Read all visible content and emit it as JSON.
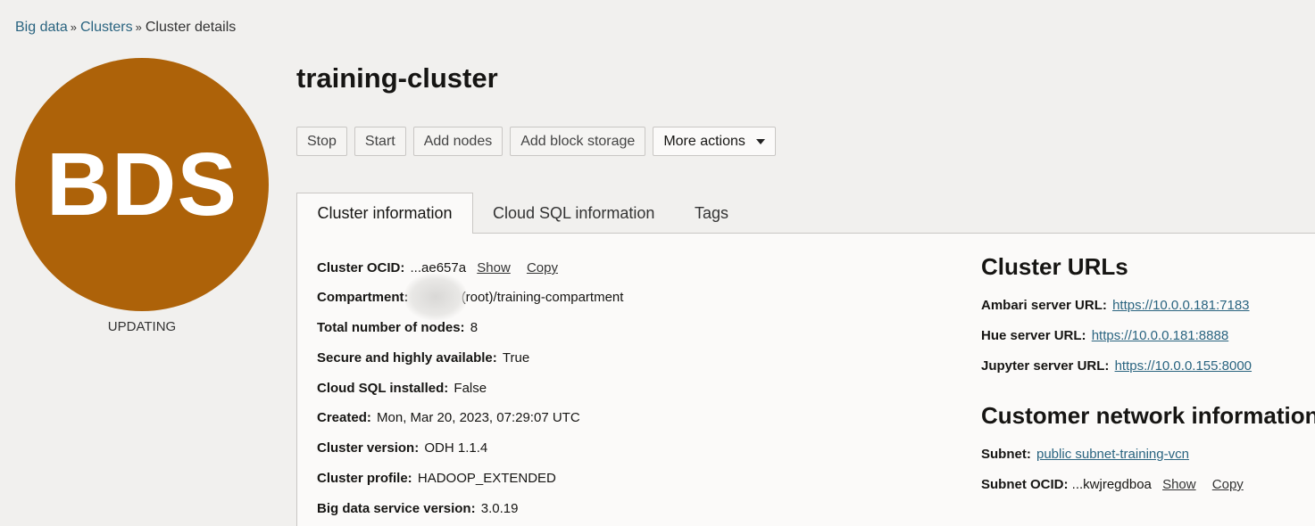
{
  "breadcrumb": {
    "items": [
      "Big data",
      "Clusters"
    ],
    "current": "Cluster details",
    "separator": "»"
  },
  "badge": {
    "text": "BDS",
    "status": "UPDATING",
    "color": "#ad6209"
  },
  "title": "training-cluster",
  "actions": {
    "stop": "Stop",
    "start": "Start",
    "add_nodes": "Add nodes",
    "add_block_storage": "Add block storage",
    "more_actions": "More actions"
  },
  "tabs": [
    "Cluster information",
    "Cloud SQL information",
    "Tags"
  ],
  "cluster_info": {
    "ocid": {
      "label": "Cluster OCID:",
      "value": "...ae657a",
      "show": "Show",
      "copy": "Copy"
    },
    "compartment": {
      "label": "Compartment:",
      "value": "(root)/training-compartment"
    },
    "total_nodes": {
      "label": "Total number of nodes:",
      "value": "8"
    },
    "secure_ha": {
      "label": "Secure and highly available:",
      "value": "True"
    },
    "cloud_sql": {
      "label": "Cloud SQL installed:",
      "value": "False"
    },
    "created": {
      "label": "Created:",
      "value": "Mon, Mar 20, 2023, 07:29:07 UTC"
    },
    "cluster_version": {
      "label": "Cluster version:",
      "value": "ODH 1.1.4"
    },
    "cluster_profile": {
      "label": "Cluster profile:",
      "value": "HADOOP_EXTENDED"
    },
    "bds_version": {
      "label": "Big data service version:",
      "value": "3.0.19"
    }
  },
  "cluster_urls": {
    "heading": "Cluster URLs",
    "ambari": {
      "label": "Ambari server URL:",
      "value": "https://10.0.0.181:7183"
    },
    "hue": {
      "label": "Hue server URL:",
      "value": "https://10.0.0.181:8888"
    },
    "jupyter": {
      "label": "Jupyter server URL:",
      "value": "https://10.0.0.155:8000"
    }
  },
  "network": {
    "heading": "Customer network information",
    "subnet": {
      "label": "Subnet:",
      "value": "public subnet-training-vcn"
    },
    "subnet_ocid": {
      "label": "Subnet OCID:",
      "value": "...kwjregdboa",
      "show": "Show",
      "copy": "Copy"
    }
  },
  "colors": {
    "link": "#2a6480",
    "accent": "#ad6209"
  }
}
